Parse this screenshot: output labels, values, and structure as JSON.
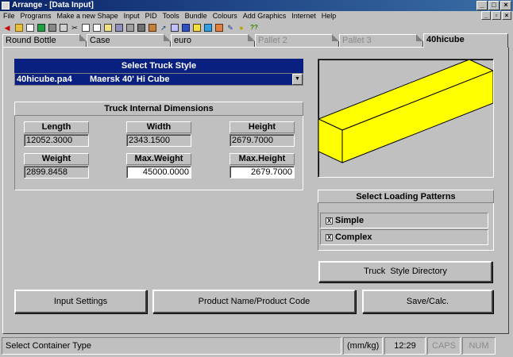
{
  "window": {
    "title": "Arrange - [Data Input]"
  },
  "menu": [
    "File",
    "Programs",
    "Make a new Shape",
    "Input",
    "PID",
    "Tools",
    "Bundle",
    "Colours",
    "Add Graphics",
    "Internet",
    "Help"
  ],
  "toolbar": {
    "back_label": "back",
    "help_label": "??"
  },
  "tabs": [
    {
      "label": "Round Bottle",
      "state": "normal"
    },
    {
      "label": "Case",
      "state": "normal"
    },
    {
      "label": "euro",
      "state": "normal"
    },
    {
      "label": "Pallet 2",
      "state": "disabled"
    },
    {
      "label": "Pallet 3",
      "state": "disabled"
    },
    {
      "label": "40hicube",
      "state": "active"
    }
  ],
  "truck_style": {
    "header": "Select Truck Style",
    "file": "40hicube.pa4",
    "name": "Maersk 40' Hi Cube"
  },
  "dimensions": {
    "header": "Truck Internal Dimensions",
    "length": {
      "label": "Length",
      "value": "12052.3000"
    },
    "width": {
      "label": "Width",
      "value": "2343.1500"
    },
    "height": {
      "label": "Height",
      "value": "2679.7000"
    },
    "weight": {
      "label": "Weight",
      "value": "2899.8458"
    },
    "max_weight": {
      "label": "Max.Weight",
      "value": "45000.0000"
    },
    "max_height": {
      "label": "Max.Height",
      "value": "2679.7000"
    }
  },
  "preview": {
    "fill_color": "#ffff00",
    "line_color": "#000000"
  },
  "loading_patterns": {
    "header": "Select Loading Patterns",
    "simple": {
      "label": "Simple",
      "checked": true,
      "mark": "X"
    },
    "complex": {
      "label": "Complex",
      "checked": true,
      "mark": "X"
    }
  },
  "buttons": {
    "truck_style_directory": "Truck  Style Directory",
    "input_settings": "Input Settings",
    "product_name": "Product Name/Product Code",
    "save_calc": "Save/Calc."
  },
  "status": {
    "message": "Select Container Type",
    "units": "(mm/kg)",
    "time": "12:29",
    "caps": "CAPS",
    "num": "NUM"
  }
}
